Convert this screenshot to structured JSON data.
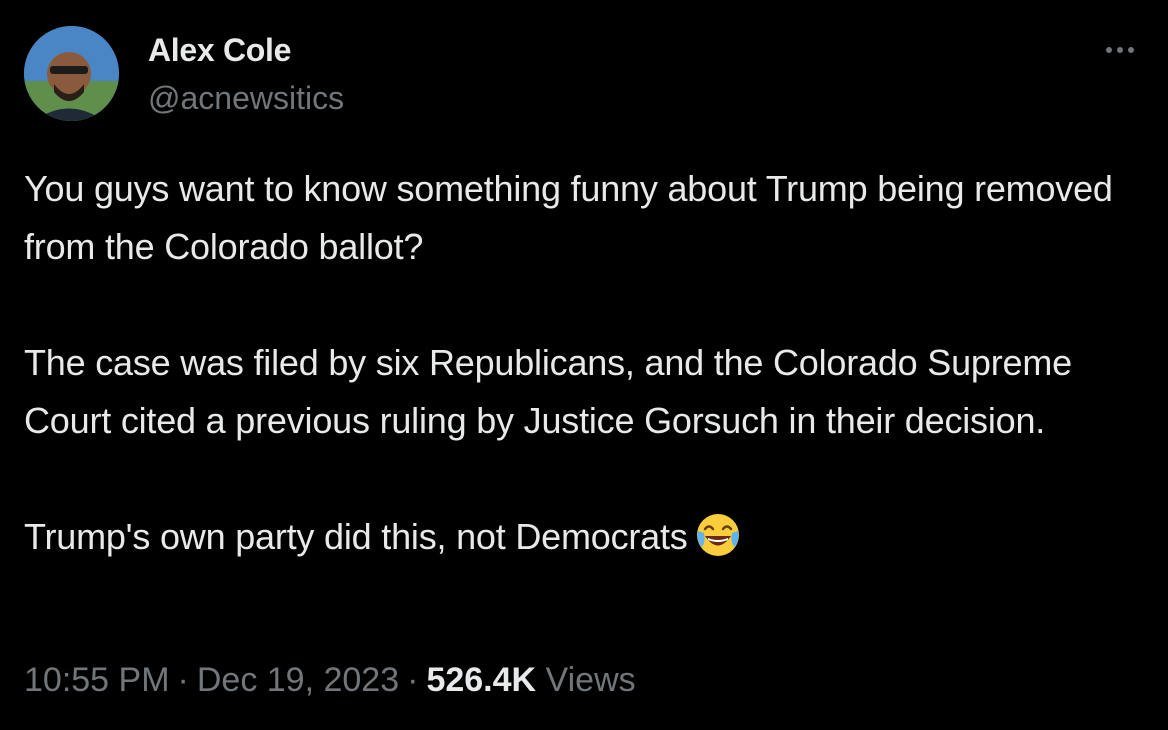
{
  "author": {
    "display_name": "Alex Cole",
    "handle": "@acnewsitics"
  },
  "tweet": {
    "paragraphs": [
      "You guys want to know something funny about Trump being removed from the Colorado ballot?",
      "The case was filed by six Republicans, and the Colorado Supreme Court cited a previous ruling by Justice Gorsuch in their decision.",
      "Trump's own party did this, not Democrats"
    ],
    "emoji": "face-with-tears-of-joy-icon"
  },
  "meta": {
    "time": "10:55 PM",
    "separator": "·",
    "date": "Dec 19, 2023",
    "views_count": "526.4K",
    "views_label": "Views"
  },
  "colors": {
    "background": "#000000",
    "primary_text": "#e7e9ea",
    "secondary_text": "#71767b"
  }
}
